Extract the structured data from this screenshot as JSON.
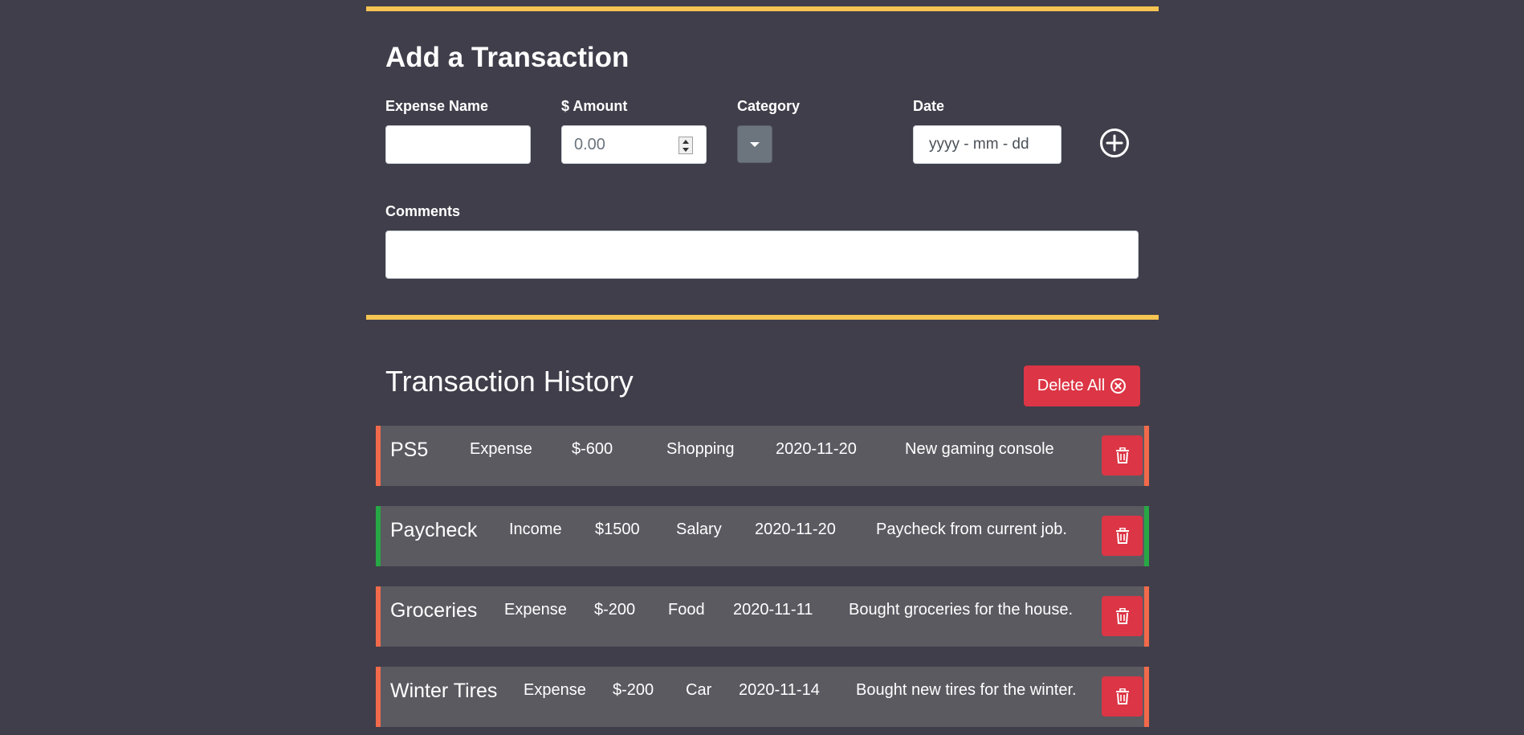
{
  "form": {
    "title": "Add a Transaction",
    "expense_name_label": "Expense Name",
    "expense_name_value": "",
    "amount_label": "$ Amount",
    "amount_placeholder": "0.00",
    "category_label": "Category",
    "date_label": "Date",
    "date_placeholder": "yyyy - mm - dd",
    "comments_label": "Comments",
    "comments_value": "",
    "add_icon": "plus-circle-icon"
  },
  "history": {
    "title": "Transaction History",
    "delete_all_label": "Delete All",
    "delete_all_icon": "x-circle-icon",
    "row_icon": "trash-icon",
    "colors": {
      "expense": "#f26a4b",
      "income": "#28a745",
      "danger": "#dc3545",
      "accent": "#f6c453"
    },
    "transactions": [
      {
        "name": "PS5",
        "type": "Expense",
        "amount": "$-600",
        "category": "Shopping",
        "date": "2020-11-20",
        "comment": "New gaming console"
      },
      {
        "name": "Paycheck",
        "type": "Income",
        "amount": "$1500",
        "category": "Salary",
        "date": "2020-11-20",
        "comment": "Paycheck from current job."
      },
      {
        "name": "Groceries",
        "type": "Expense",
        "amount": "$-200",
        "category": "Food",
        "date": "2020-11-11",
        "comment": "Bought groceries for the house."
      },
      {
        "name": "Winter Tires",
        "type": "Expense",
        "amount": "$-200",
        "category": "Car",
        "date": "2020-11-14",
        "comment": "Bought new tires for the winter."
      }
    ]
  }
}
